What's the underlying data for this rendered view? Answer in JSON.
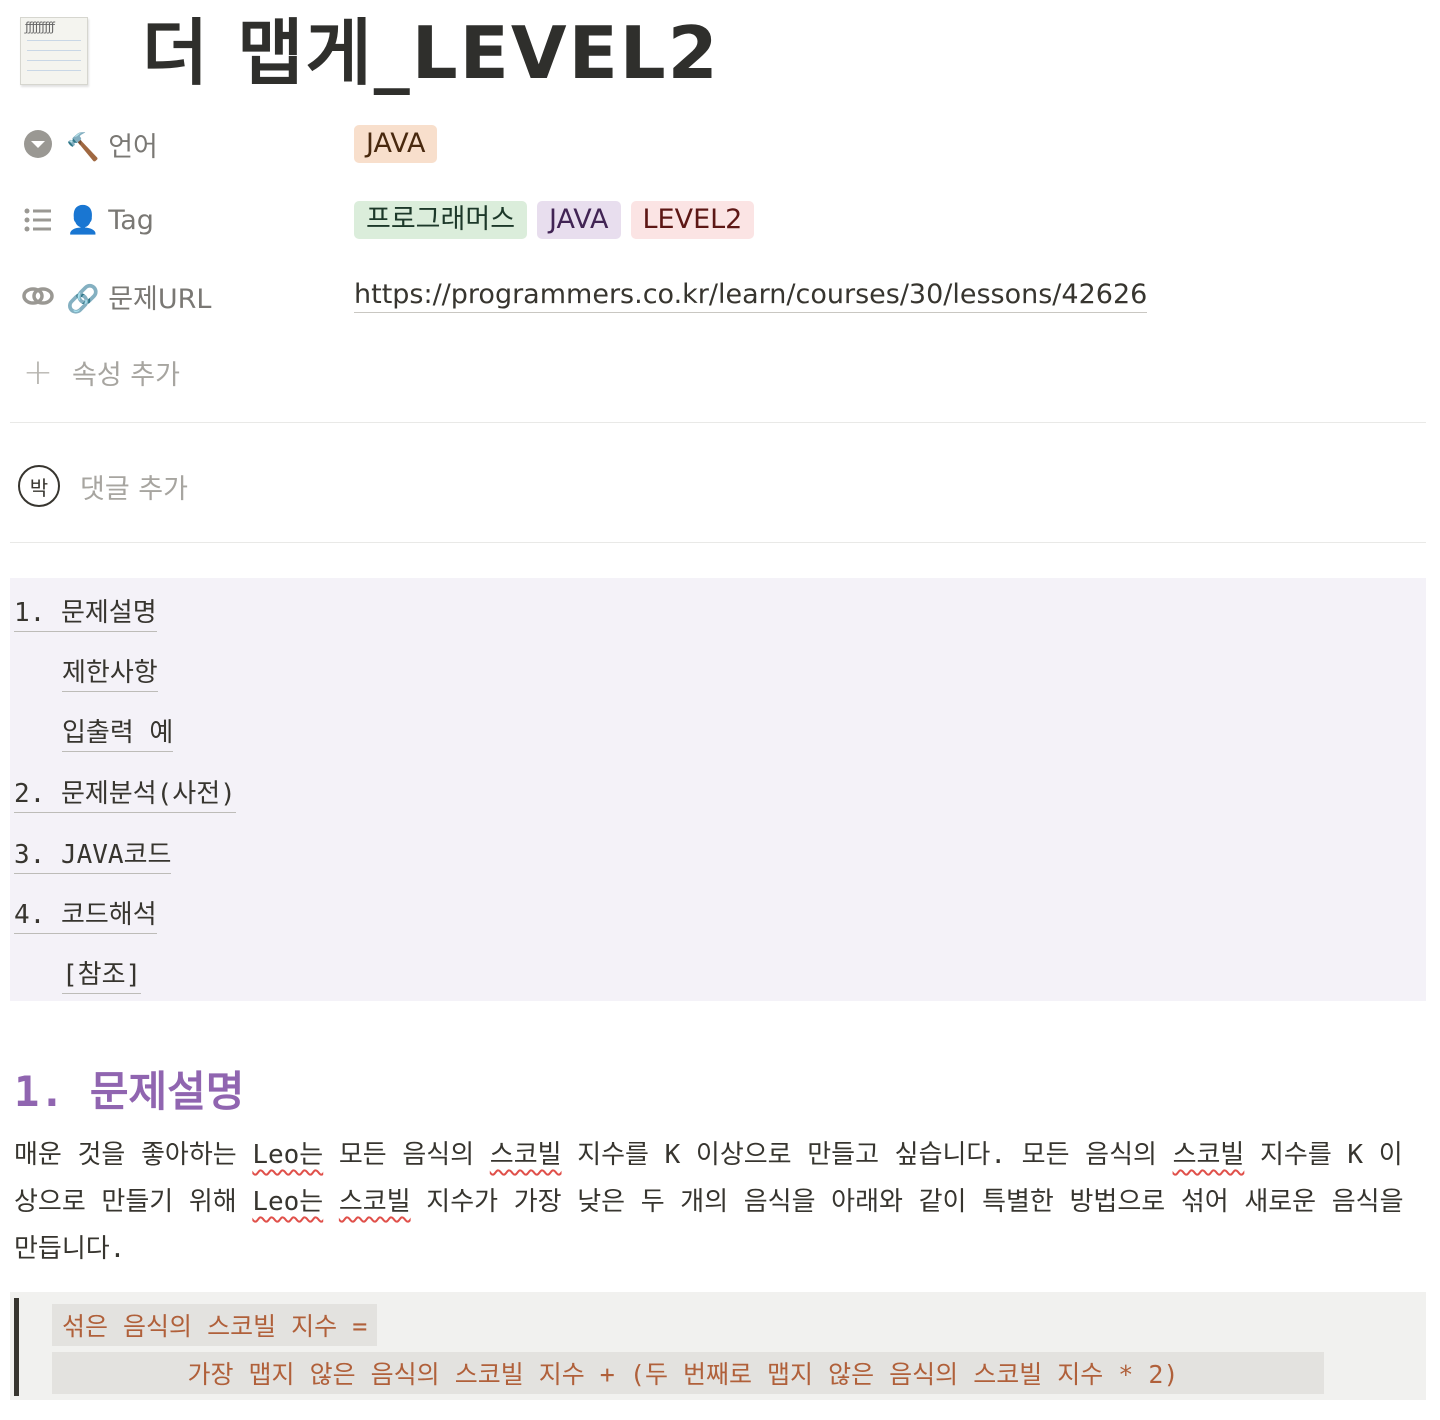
{
  "page": {
    "icon": "notepad-icon",
    "title": "더 맵게_LEVEL2"
  },
  "properties": {
    "language": {
      "label": "🔨 언어",
      "icon": "chevron-down-circle-icon",
      "values": [
        {
          "text": "JAVA",
          "bg": "#f8dfcc",
          "fg": "#49290e"
        }
      ]
    },
    "tag": {
      "label": "👤 Tag",
      "icon": "list-icon",
      "values": [
        {
          "text": "프로그래머스",
          "bg": "#dbeddb",
          "fg": "#1c3829"
        },
        {
          "text": "JAVA",
          "bg": "#e8deee",
          "fg": "#412454"
        },
        {
          "text": "LEVEL2",
          "bg": "#fbe4e4",
          "fg": "#5d1715"
        }
      ]
    },
    "url": {
      "label": "🔗 문제URL",
      "icon": "link-icon",
      "value": "https://programmers.co.kr/learn/courses/30/lessons/42626"
    },
    "add_property_label": "속성 추가"
  },
  "comment": {
    "avatar_text": "박",
    "placeholder": "댓글 추가"
  },
  "toc": {
    "items": [
      {
        "text": "1. 문제설명"
      },
      {
        "text": "제한사항"
      },
      {
        "text": "입출력 예"
      },
      {
        "text": "2. 문제분석(사전)"
      },
      {
        "text": "3. JAVA코드"
      },
      {
        "text": "4. 코드해석"
      },
      {
        "text": "[참조]"
      }
    ]
  },
  "section1": {
    "heading": "1. 문제설명",
    "para": {
      "p1": "매운 것을 좋아하는 ",
      "w1": "Leo는",
      "p2": " 모든 음식의 ",
      "w2": "스코빌",
      "p3": " 지수를 K 이상으로 만들고 싶습니다. 모든 음식의 ",
      "w3": "스코빌",
      "p4": " 지수를 K 이상으로 만들기 위해 ",
      "w4": "Leo는",
      "p5": " ",
      "w5": "스코빌",
      "p6": " 지수가 가장 낮은 두 개의 음식을 아래와 같이 특별한 방법으로 섞어 새로운 음식을 만듭니다."
    },
    "code_line1": "섞은 음식의 스코빌 지수 =",
    "code_line2": "가장 맵지 않은 음식의 스코빌 지수 + (두 번째로 맵지 않은 음식의 스코빌 지수 * 2)"
  }
}
